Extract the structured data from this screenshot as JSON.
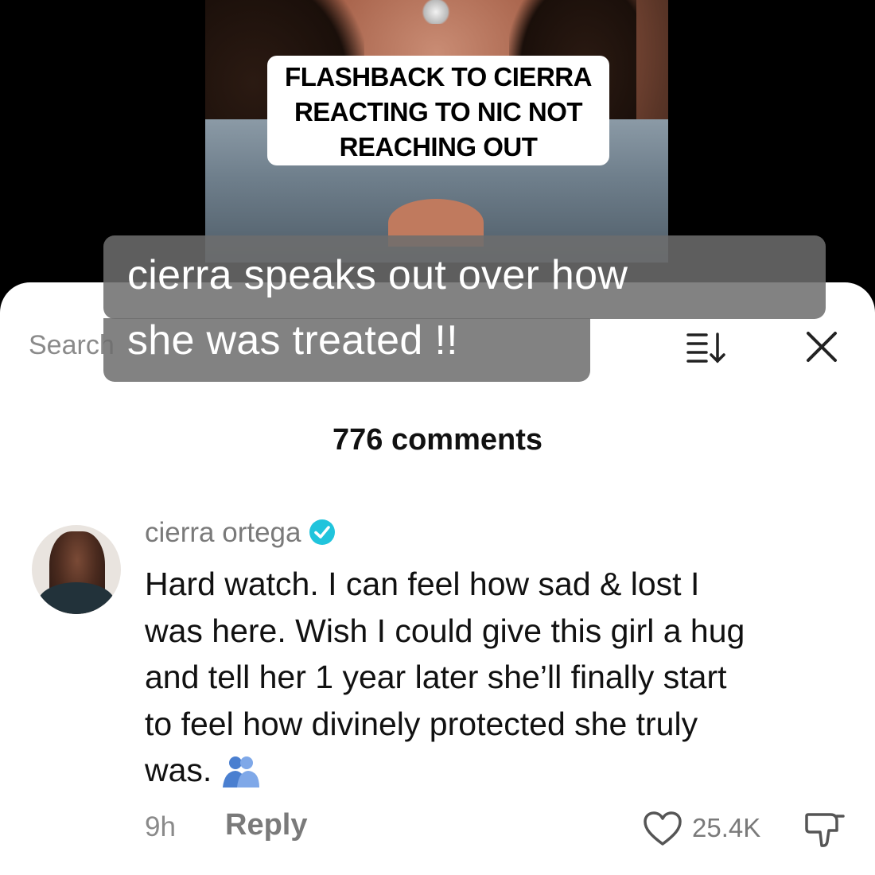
{
  "video": {
    "caption_lines": [
      "FLASHBACK TO CIERRA",
      "REACTING TO NIC NOT",
      "REACHING OUT"
    ]
  },
  "overlay": {
    "lines": [
      "cierra speaks out over how",
      "she was treated !!"
    ]
  },
  "comments_panel": {
    "search_placeholder": "Search",
    "sort_icon": "sort-icon",
    "close_icon": "close-icon",
    "count_label": "776 comments"
  },
  "comment": {
    "username": "cierra ortega",
    "verified_icon": "verified-badge-icon",
    "verified_color": "#20c4dc",
    "text_lines": [
      "Hard watch. I can feel how sad & lost I",
      "was here. Wish I could give this girl a hug",
      "and tell her 1 year later she’ll finally start",
      "to feel how divinely protected she truly",
      "was."
    ],
    "emoji": "people-hugging-emoji",
    "emoji_color": "#4a7fd0",
    "time": "9h",
    "reply_label": "Reply",
    "likes": "25.4K",
    "like_icon": "heart-icon",
    "dislike_icon": "thumbs-down-icon"
  }
}
